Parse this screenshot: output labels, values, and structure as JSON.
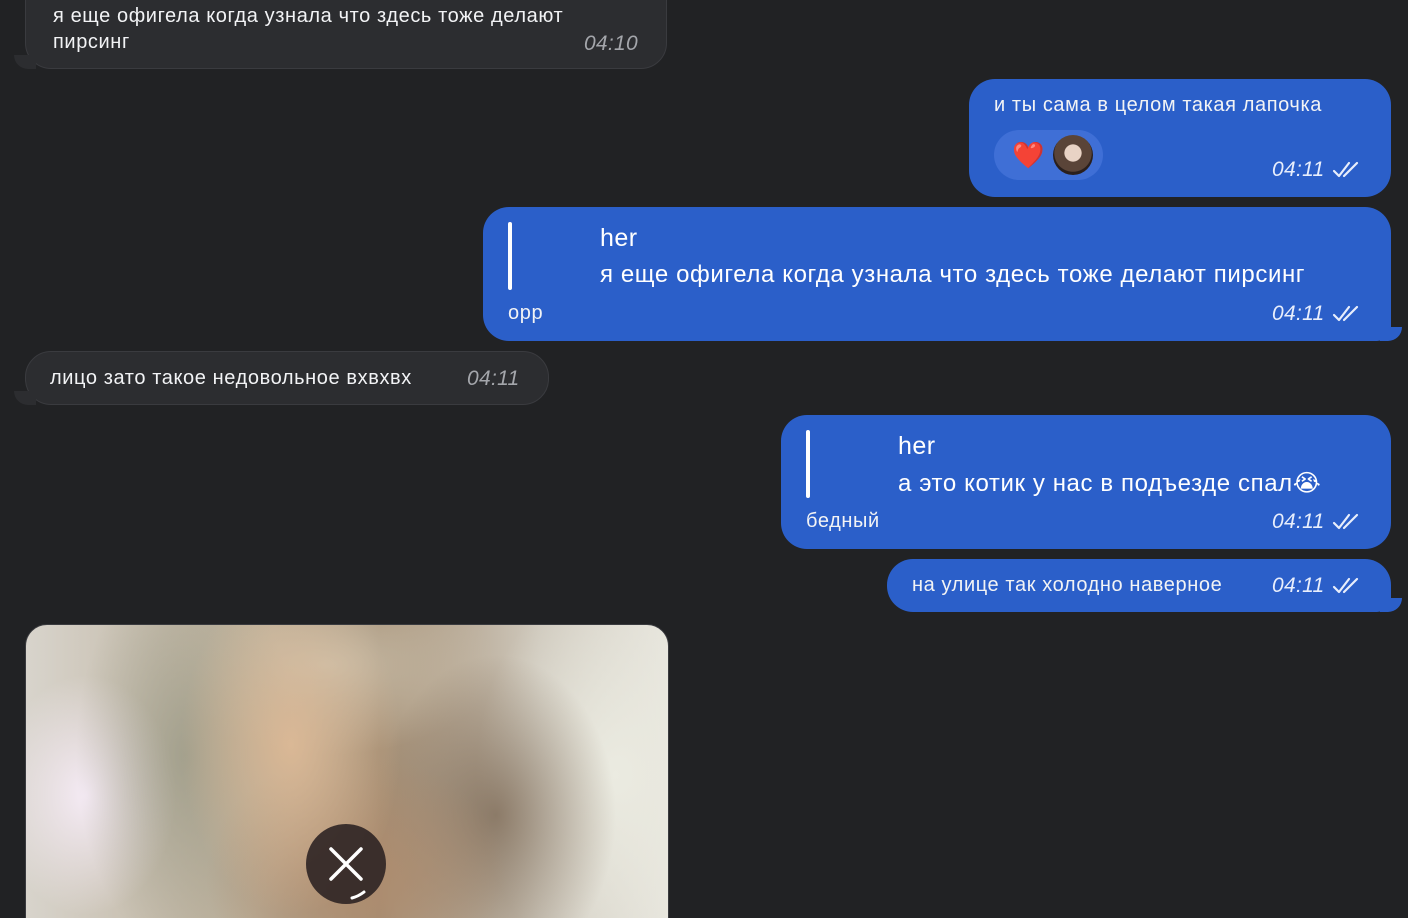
{
  "colors": {
    "background": "#212224",
    "incoming_bubble": "#2c2d30",
    "outgoing_bubble": "#2b5fc9",
    "text": "#ffffff"
  },
  "messages": {
    "m1": {
      "text_line1": "я еще офигела когда узнала что здесь тоже делают",
      "text_line2": "пирсинг",
      "time": "04:10"
    },
    "m2": {
      "text": "и ты сама в целом такая лапочка",
      "reaction_emoji": "❤️",
      "reaction_avatar": "avatar",
      "time": "04:11"
    },
    "m3": {
      "reply_name": "her",
      "reply_text": "я еще офигела когда узнала что здесь тоже делают пирсинг",
      "text": "орр",
      "time": "04:11"
    },
    "m4": {
      "text": "лицо зато такое недовольное вхвхвх",
      "time": "04:11"
    },
    "m5": {
      "reply_name": "her",
      "reply_text": "а это котик у нас в подъезде спал",
      "reply_emoji": "😭",
      "text": "бедный",
      "time": "04:11"
    },
    "m6": {
      "text": "на улице так холодно наверное",
      "time": "04:11"
    },
    "m7": {
      "type": "photo",
      "action_icon": "close-icon"
    }
  }
}
